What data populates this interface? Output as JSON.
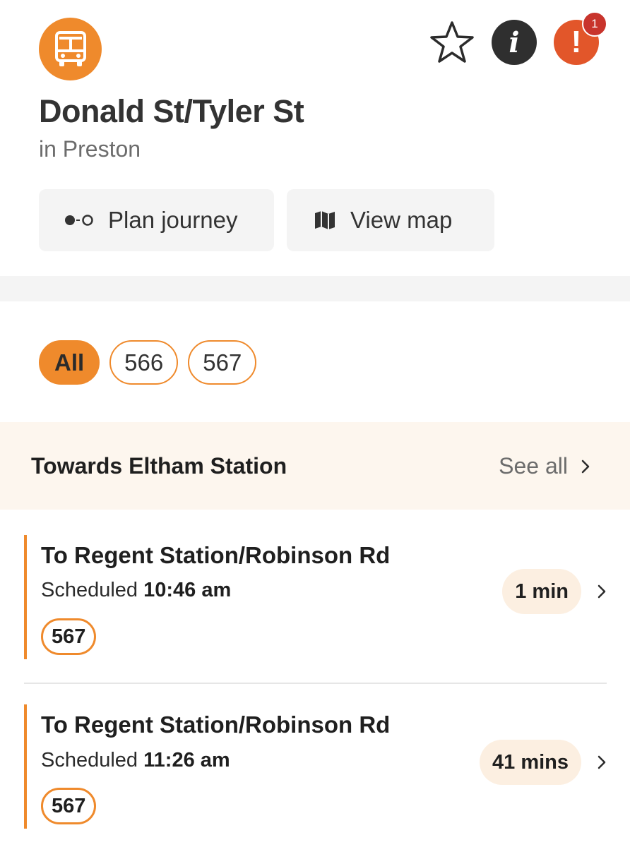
{
  "header": {
    "mode_icon": "bus-icon",
    "favourite_icon": "star-outline-icon",
    "info_icon_glyph": "i",
    "alert_icon_glyph": "!",
    "alert_count": "1",
    "accent_color": "#ef8a2c",
    "alert_color": "#e2562a"
  },
  "stop": {
    "name": "Donald St/Tyler St",
    "suburb": "in Preston"
  },
  "actions": {
    "plan_journey": "Plan journey",
    "view_map": "View map"
  },
  "filters": {
    "items": [
      {
        "label": "All",
        "selected": true
      },
      {
        "label": "566",
        "selected": false
      },
      {
        "label": "567",
        "selected": false
      }
    ]
  },
  "direction": {
    "title": "Towards Eltham Station",
    "see_all": "See all"
  },
  "departures": [
    {
      "destination": "To Regent Station/Robinson Rd",
      "scheduled_prefix": "Scheduled",
      "scheduled_time": "10:46 am",
      "route": "567",
      "eta": "1 min"
    },
    {
      "destination": "To Regent Station/Robinson Rd",
      "scheduled_prefix": "Scheduled",
      "scheduled_time": "11:26 am",
      "route": "567",
      "eta": "41 mins"
    }
  ]
}
